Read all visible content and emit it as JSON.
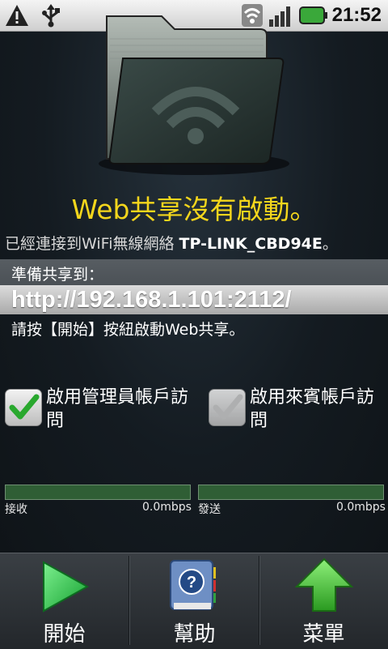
{
  "status_bar": {
    "icons": [
      "warning-icon",
      "usb-icon",
      "wifi-icon",
      "signal-icon",
      "battery-icon"
    ],
    "time": "21:52"
  },
  "main": {
    "folder_icon": "shared-folder-wifi-icon",
    "title": "Web共享沒有啟動。",
    "connected_prefix": "已經連接到WiFi無線網絡 ",
    "network_name": "TP-LINK_CBD94E",
    "connected_suffix": "。",
    "prepare_label": "準備共享到：",
    "url": "http://192.168.1.101:2112/",
    "instruction": "請按【開始】按紐啟動Web共享。"
  },
  "options": {
    "admin_access": {
      "label": "啟用管理員帳戶訪問",
      "checked": true
    },
    "guest_access": {
      "label": "啟用來賓帳戶訪問",
      "checked": false
    }
  },
  "meters": {
    "receive": {
      "label": "接收",
      "value": "0.0mbps"
    },
    "send": {
      "label": "發送",
      "value": "0.0mbps"
    }
  },
  "toolbar": {
    "start_label": "開始",
    "help_label": "幫助",
    "menu_label": "菜單"
  },
  "colors": {
    "title": "#f4d61c",
    "meter": "#2f5e35",
    "check": "#29a82e",
    "play": "#2fc24a"
  }
}
